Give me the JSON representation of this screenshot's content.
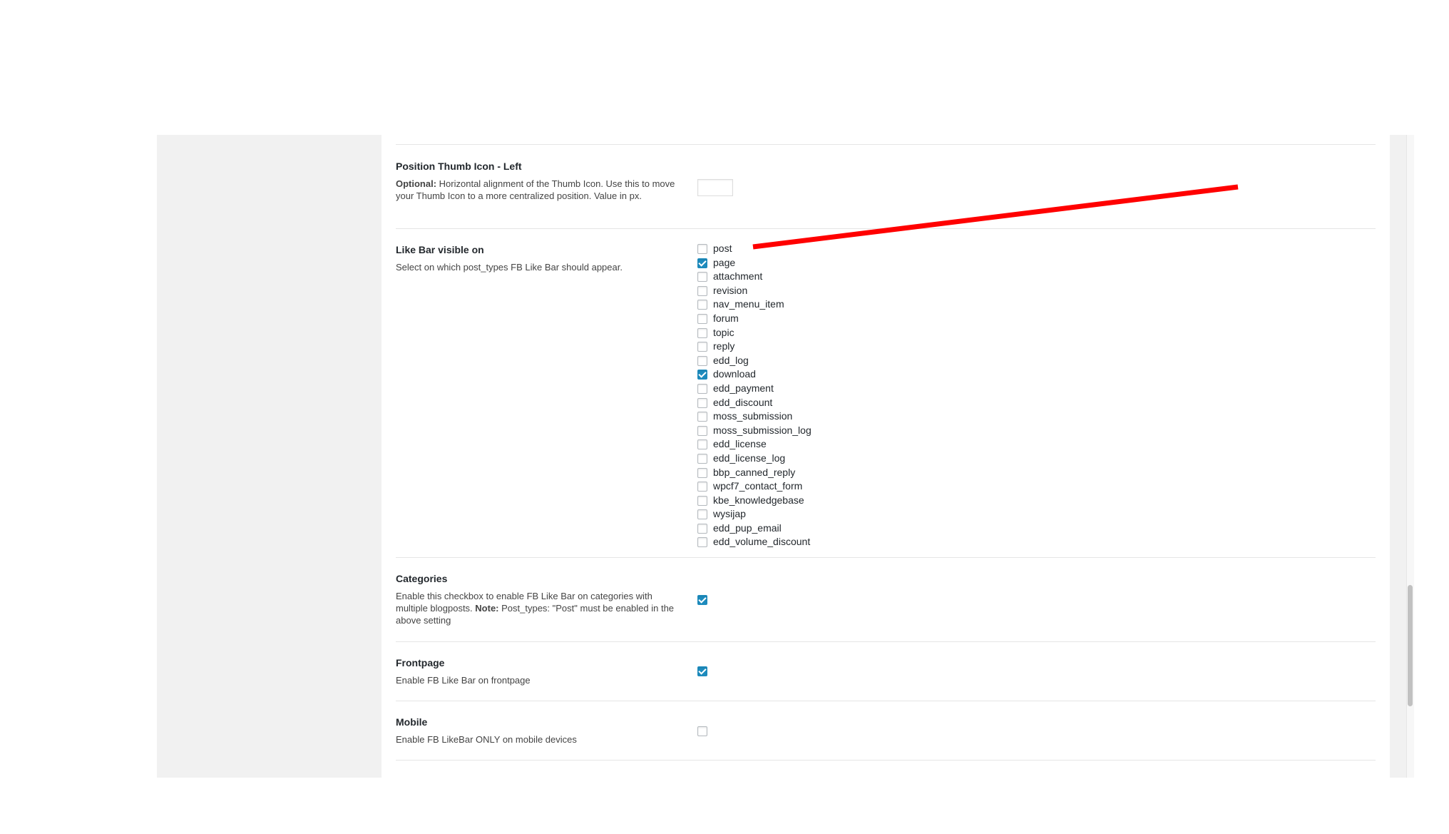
{
  "settings": {
    "thumb_left": {
      "title": "Position Thumb Icon - Left",
      "desc_bold": "Optional:",
      "desc": " Horizontal alignment of the Thumb Icon. Use this to move your Thumb Icon to a more centralized position. Value in px.",
      "value": ""
    },
    "like_bar_visible": {
      "title": "Like Bar visible on",
      "desc": "Select on which post_types FB Like Bar should appear.",
      "post_types": [
        {
          "label": "post",
          "checked": false
        },
        {
          "label": "page",
          "checked": true
        },
        {
          "label": "attachment",
          "checked": false
        },
        {
          "label": "revision",
          "checked": false
        },
        {
          "label": "nav_menu_item",
          "checked": false
        },
        {
          "label": "forum",
          "checked": false
        },
        {
          "label": "topic",
          "checked": false
        },
        {
          "label": "reply",
          "checked": false
        },
        {
          "label": "edd_log",
          "checked": false
        },
        {
          "label": "download",
          "checked": true
        },
        {
          "label": "edd_payment",
          "checked": false
        },
        {
          "label": "edd_discount",
          "checked": false
        },
        {
          "label": "moss_submission",
          "checked": false
        },
        {
          "label": "moss_submission_log",
          "checked": false
        },
        {
          "label": "edd_license",
          "checked": false
        },
        {
          "label": "edd_license_log",
          "checked": false
        },
        {
          "label": "bbp_canned_reply",
          "checked": false
        },
        {
          "label": "wpcf7_contact_form",
          "checked": false
        },
        {
          "label": "kbe_knowledgebase",
          "checked": false
        },
        {
          "label": "wysijap",
          "checked": false
        },
        {
          "label": "edd_pup_email",
          "checked": false
        },
        {
          "label": "edd_volume_discount",
          "checked": false
        }
      ]
    },
    "categories": {
      "title": "Categories",
      "desc_a": "Enable this checkbox to enable FB Like Bar on categories with multiple blogposts. ",
      "desc_bold": "Note:",
      "desc_b": " Post_types: \"Post\" must be enabled in the above setting",
      "checked": true
    },
    "frontpage": {
      "title": "Frontpage",
      "desc": "Enable FB Like Bar on frontpage",
      "checked": true
    },
    "mobile": {
      "title": "Mobile",
      "desc": "Enable FB LikeBar ONLY on mobile devices",
      "checked": false
    }
  },
  "annotation": {
    "color": "#ff0000"
  }
}
